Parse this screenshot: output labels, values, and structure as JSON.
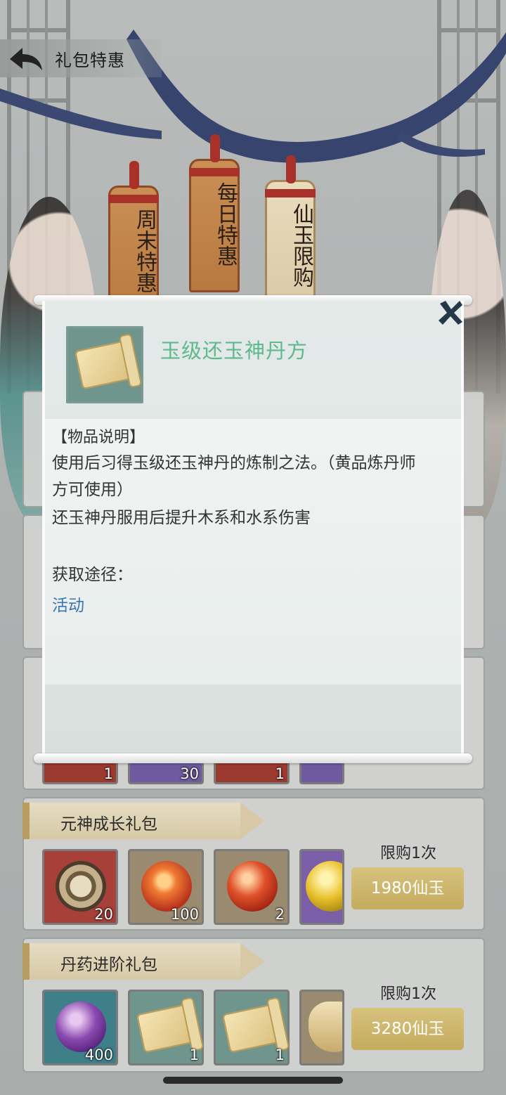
{
  "header": {
    "title": "礼包特惠",
    "back_icon": "back-arrow-icon"
  },
  "tabs": [
    {
      "label": "周末特惠"
    },
    {
      "label": "每日特惠"
    },
    {
      "label": "仙玉限购"
    }
  ],
  "modal": {
    "item_name": "玉级还玉神丹方",
    "item_icon": "scroll-icon",
    "desc_header": "【物品说明】",
    "description": "使用后习得玉级还玉神丹的炼制之法。（黄品炼丹师方可使用）",
    "description_2": "还玉神丹服用后提升木系和水系伤害",
    "source_label": "获取途径：",
    "source_value": "活动",
    "close_icon": "close-icon"
  },
  "packages": [
    {
      "title": "",
      "items": [
        {
          "icon": "red-item",
          "count": "1"
        },
        {
          "icon": "purple-scroll",
          "count": "30"
        },
        {
          "icon": "red-chest",
          "count": "1"
        }
      ]
    },
    {
      "title": "元神成长礼包",
      "limit": "限购1次",
      "price": "1980仙玉",
      "items": [
        {
          "icon": "bronze-disc-icon",
          "count": "20"
        },
        {
          "icon": "fire-orb-icon",
          "count": "100"
        },
        {
          "icon": "red-pearl-icon",
          "count": "2"
        },
        {
          "icon": "gold-pearl-icon",
          "count": ""
        }
      ]
    },
    {
      "title": "丹药进阶礼包",
      "limit": "限购1次",
      "price": "3280仙玉",
      "items": [
        {
          "icon": "purple-crystal-icon",
          "count": "400"
        },
        {
          "icon": "recipe-scroll-icon",
          "count": "1"
        },
        {
          "icon": "recipe-scroll-icon",
          "count": "1"
        },
        {
          "icon": "pouch-icon",
          "count": ""
        }
      ]
    }
  ]
}
